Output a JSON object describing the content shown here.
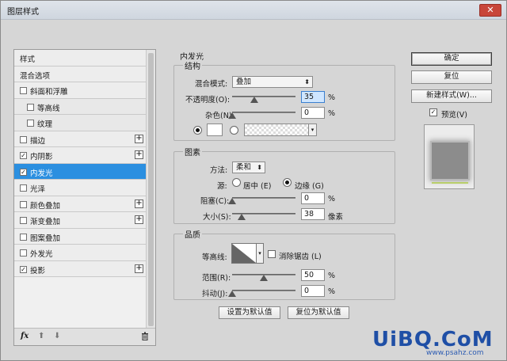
{
  "window": {
    "title": "图层样式",
    "close_glyph": "✕"
  },
  "sidebar": {
    "items": [
      {
        "label": "样式",
        "checkbox": false,
        "plus": false,
        "sub": false,
        "selected": false
      },
      {
        "label": "混合选项",
        "checkbox": false,
        "plus": false,
        "sub": false,
        "selected": false
      },
      {
        "label": "斜面和浮雕",
        "checkbox": true,
        "checked": false,
        "plus": false,
        "sub": false,
        "selected": false
      },
      {
        "label": "等高线",
        "checkbox": true,
        "checked": false,
        "plus": false,
        "sub": true,
        "selected": false
      },
      {
        "label": "纹理",
        "checkbox": true,
        "checked": false,
        "plus": false,
        "sub": true,
        "selected": false
      },
      {
        "label": "描边",
        "checkbox": true,
        "checked": false,
        "plus": true,
        "sub": false,
        "selected": false
      },
      {
        "label": "内阴影",
        "checkbox": true,
        "checked": true,
        "plus": true,
        "sub": false,
        "selected": false
      },
      {
        "label": "内发光",
        "checkbox": true,
        "checked": true,
        "plus": false,
        "sub": false,
        "selected": true
      },
      {
        "label": "光泽",
        "checkbox": true,
        "checked": false,
        "plus": false,
        "sub": false,
        "selected": false
      },
      {
        "label": "颜色叠加",
        "checkbox": true,
        "checked": false,
        "plus": true,
        "sub": false,
        "selected": false
      },
      {
        "label": "渐变叠加",
        "checkbox": true,
        "checked": false,
        "plus": true,
        "sub": false,
        "selected": false
      },
      {
        "label": "图案叠加",
        "checkbox": true,
        "checked": false,
        "plus": false,
        "sub": false,
        "selected": false
      },
      {
        "label": "外发光",
        "checkbox": true,
        "checked": false,
        "plus": false,
        "sub": false,
        "selected": false
      },
      {
        "label": "投影",
        "checkbox": true,
        "checked": true,
        "plus": true,
        "sub": false,
        "selected": false
      }
    ],
    "footer": {
      "fx": "fx",
      "up": "⬆",
      "down": "⬇",
      "trash": "🗑"
    }
  },
  "panel": {
    "title": "内发光",
    "structure": {
      "title": "结构",
      "blend_mode_label": "混合模式:",
      "blend_mode_value": "叠加",
      "opacity_label": "不透明度(O):",
      "opacity_value": "35",
      "opacity_unit": "%",
      "noise_label": "杂色(N):",
      "noise_value": "0",
      "noise_unit": "%",
      "dropdown_arrow": "▾"
    },
    "elements": {
      "title": "图素",
      "method_label": "方法:",
      "method_value": "柔和",
      "source_label": "源:",
      "source_center": "居中 (E)",
      "source_edge": "边缘 (G)",
      "choke_label": "阻塞(C):",
      "choke_value": "0",
      "choke_unit": "%",
      "size_label": "大小(S):",
      "size_value": "38",
      "size_unit": "像素"
    },
    "quality": {
      "title": "品质",
      "contour_label": "等高线:",
      "antialias_label": "消除锯齿 (L)",
      "range_label": "范围(R):",
      "range_value": "50",
      "range_unit": "%",
      "jitter_label": "抖动(J):",
      "jitter_value": "0",
      "jitter_unit": "%"
    },
    "make_default": "设置为默认值",
    "reset_default": "复位为默认值"
  },
  "right": {
    "ok": "确定",
    "reset": "复位",
    "new_style": "新建样式(W)...",
    "preview_label": "预览(V)",
    "preview_checked": true
  },
  "watermark": {
    "text": "UiBQ.CoM",
    "sub": "www.psahz.com"
  }
}
